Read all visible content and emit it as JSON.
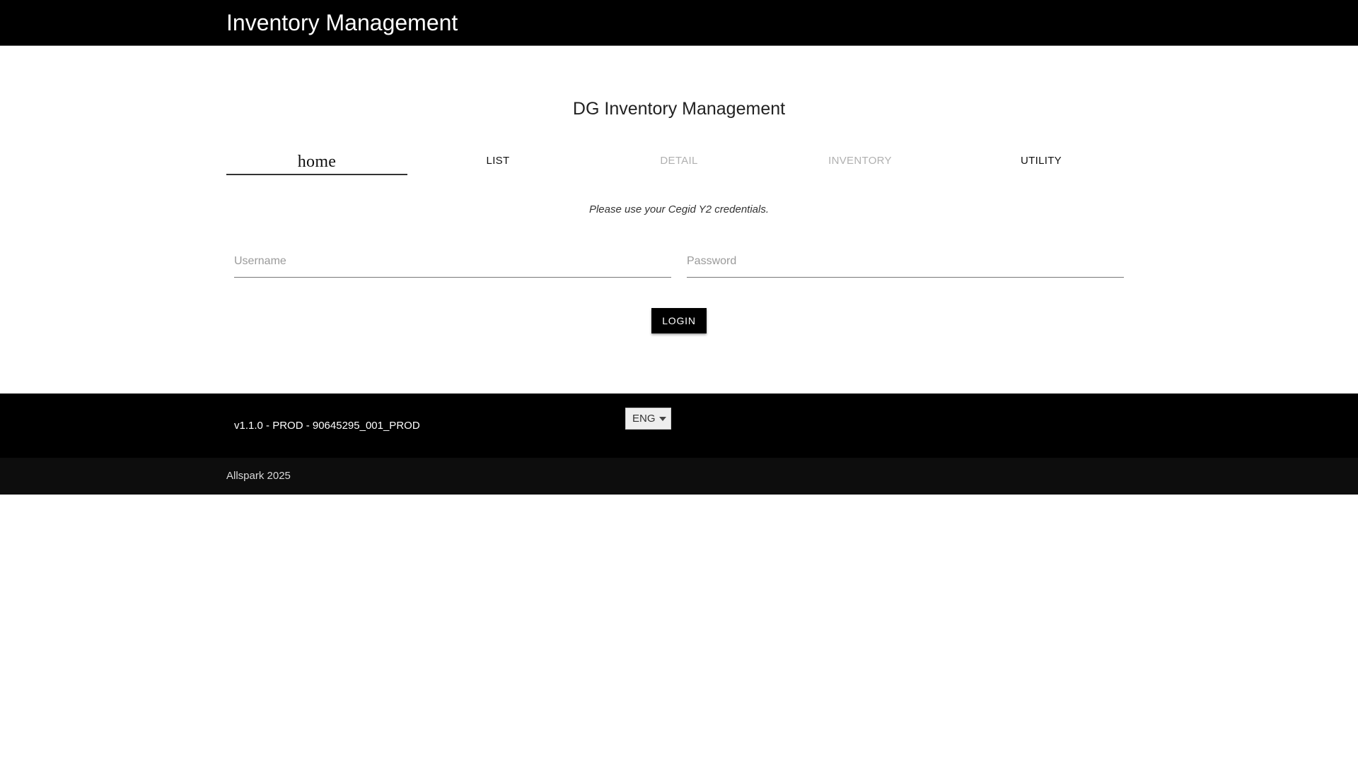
{
  "header": {
    "app_title": "Inventory Management"
  },
  "main": {
    "heading": "DG Inventory Management",
    "tabs": [
      {
        "label": "home",
        "active": true,
        "enabled": true
      },
      {
        "label": "LIST",
        "active": false,
        "enabled": true
      },
      {
        "label": "DETAIL",
        "active": false,
        "enabled": false
      },
      {
        "label": "INVENTORY",
        "active": false,
        "enabled": false
      },
      {
        "label": "UTILITY",
        "active": false,
        "enabled": true
      }
    ],
    "hint": "Please use your Cegid Y2 credentials.",
    "username": {
      "placeholder": "Username",
      "value": ""
    },
    "password": {
      "placeholder": "Password",
      "value": ""
    },
    "login_label": "LOGIN"
  },
  "footer": {
    "version": "v1.1.0 - PROD - 90645295_001_PROD",
    "language": "ENG",
    "copyright": "Allspark 2025"
  },
  "colors": {
    "header_bg": "#000000",
    "footer_bg": "#000000",
    "button_bg": "#000000",
    "disabled_text": "#b0b0b0"
  }
}
